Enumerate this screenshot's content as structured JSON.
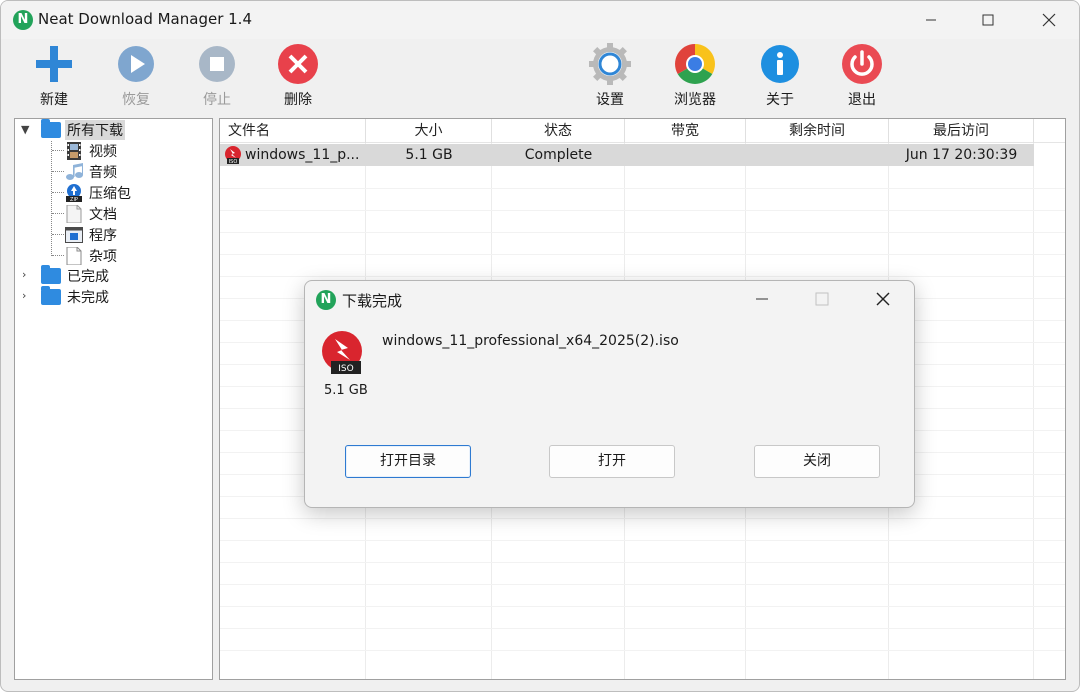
{
  "window": {
    "title": "Neat Download Manager 1.4",
    "logo_letter": "N"
  },
  "toolbar": {
    "new_label": "新建",
    "resume_label": "恢复",
    "stop_label": "停止",
    "delete_label": "删除",
    "settings_label": "设置",
    "browser_label": "浏览器",
    "about_label": "关于",
    "exit_label": "退出"
  },
  "sidebar": {
    "root": "所有下载",
    "children": [
      "视频",
      "音频",
      "压缩包",
      "文档",
      "程序",
      "杂项"
    ],
    "completed": "已完成",
    "incomplete": "未完成"
  },
  "list": {
    "columns": [
      "文件名",
      "大小",
      "状态",
      "带宽",
      "剩余时间",
      "最后访问"
    ],
    "rows": [
      {
        "name": "windows_11_p...",
        "size": "5.1 GB",
        "status": "Complete",
        "bandwidth": "",
        "remaining": "",
        "last_access": "Jun 17 20:30:39"
      }
    ]
  },
  "dialog": {
    "title": "下载完成",
    "filename": "windows_11_professional_x64_2025(2).iso",
    "size": "5.1 GB",
    "file_badge": "ISO",
    "open_folder_label": "打开目录",
    "open_label": "打开",
    "close_label": "关闭"
  },
  "colors": {
    "accent_blue": "#2e7ad1",
    "brand_green": "#22a35a",
    "delete_red": "#e8414b",
    "exit_red": "#ea4a53",
    "about_blue": "#1e8fe0"
  },
  "icons": {
    "new": "plus-icon",
    "resume": "play-icon",
    "stop": "stop-icon",
    "delete": "x-circle-icon",
    "settings": "gear-icon",
    "browser": "chrome-icon",
    "about": "info-icon",
    "exit": "power-icon"
  }
}
